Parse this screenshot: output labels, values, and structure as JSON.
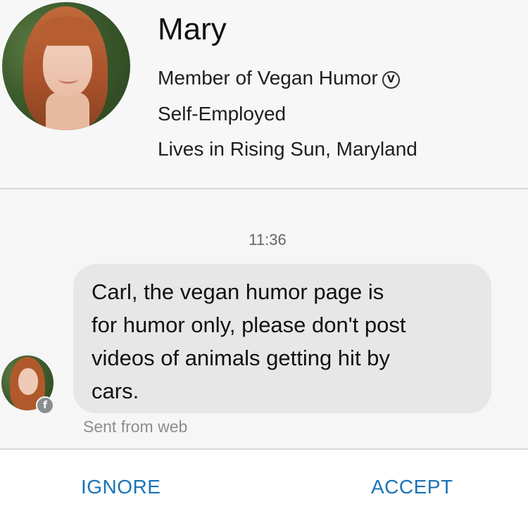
{
  "profile": {
    "name": "Mary",
    "membership": "Member of Vegan Humor",
    "membership_badge": "V",
    "work": "Self-Employed",
    "location": "Lives in Rising Sun, Maryland"
  },
  "thread": {
    "timestamp": "11:36",
    "message": {
      "text_lines": [
        "Carl, the vegan humor page is",
        "for humor only, please don't post",
        "videos of animals getting hit by",
        "cars."
      ],
      "sent_from": "Sent from web"
    },
    "sender_badge_icon": "f"
  },
  "actions": {
    "ignore_label": "IGNORE",
    "accept_label": "ACCEPT"
  },
  "colors": {
    "action_blue": "#1a73b6",
    "bubble_gray": "#e7e7e7",
    "meta_gray": "#8d8d8d"
  }
}
